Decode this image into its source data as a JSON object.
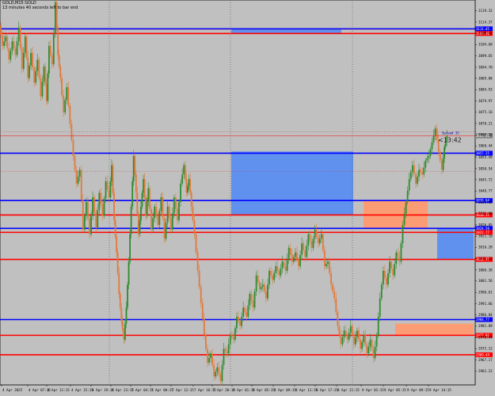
{
  "header": {
    "symbol_line": "GOLD,M15 GOLD",
    "timer_line": "13 minutes 40 seconds left to bar end"
  },
  "countdown": "<13:42",
  "spread_label": "Spread 35",
  "colors": {
    "background": "#c0c0c0",
    "bull_candle": "#2e8b2e",
    "bear_candle": "#e07a3c",
    "support_line": "#ff0000",
    "resistance_line": "#0000ff",
    "demand_zone": "#5c8ef0",
    "supply_zone": "#ff9a70",
    "price_line": "#ff0000"
  },
  "chart_data": {
    "type": "candlestick",
    "current_price": 3064.8,
    "ylim": [
      2956.3,
      3124.0
    ],
    "y_ticks": [
      "3119.32",
      "3114.37",
      "3109.42",
      "3104.60",
      "3099.65",
      "3094.70",
      "3089.88",
      "3084.93",
      "3079.97",
      "3075.16",
      "3070.21",
      "3065.26",
      "3060.44",
      "3055.49",
      "3050.54",
      "3045.72",
      "3040.77",
      "3035.82",
      "3031.00",
      "3026.05",
      "3021.10",
      "3016.28",
      "3011.33",
      "3006.38",
      "3001.56",
      "2996.61",
      "2991.66",
      "2986.84",
      "2981.89",
      "2976.94",
      "2972.12",
      "2967.17",
      "2962.22"
    ],
    "x_labels": [
      "4 Apr 2025",
      "4 Apr 07:15",
      "4 Apr 11:15",
      "4 Apr 15:15",
      "4 Apr 19:15",
      "4 Apr 23:15",
      "7 Apr 04:15",
      "7 Apr 08:15",
      "7 Apr 12:15",
      "7 Apr 16:15",
      "7 Apr 20:15",
      "8 Apr 01:15",
      "8 Apr 05:15",
      "8 Apr 09:15",
      "8 Apr 13:15",
      "8 Apr 17:15",
      "8 Apr 21:15",
      "9 Apr 01:15",
      "9 Apr 05:15",
      "9 Apr 09:15",
      "9 Apr 14:15"
    ],
    "horizontal_levels": [
      {
        "price": 3111.45,
        "label": "3111.45",
        "kind": "resistance"
      },
      {
        "price": 3109.4,
        "label": "3109.40",
        "kind": "support"
      },
      {
        "price": 3057.25,
        "label": "3057.25",
        "kind": "resistance"
      },
      {
        "price": 3036.64,
        "label": "3036.64",
        "kind": "resistance"
      },
      {
        "price": 3030.35,
        "label": "3030.35",
        "kind": "support"
      },
      {
        "price": 3024.5,
        "label": "3024.50",
        "kind": "resistance"
      },
      {
        "price": 3022.77,
        "label": "3022.77",
        "kind": "support"
      },
      {
        "price": 3010.97,
        "label": "3010.97",
        "kind": "support"
      },
      {
        "price": 2984.77,
        "label": "2984.77",
        "kind": "resistance"
      },
      {
        "price": 2977.91,
        "label": "2977.91",
        "kind": "support"
      },
      {
        "price": 2969.44,
        "label": "2969.44",
        "kind": "support"
      }
    ],
    "dotted_levels": [
      3111.0,
      3066.5,
      3049.4
    ],
    "zones": [
      {
        "kind": "demand",
        "from": "7 Apr 23:45",
        "to": "8 Apr 18:15",
        "top": 3111.45,
        "bottom": 3109.4
      },
      {
        "kind": "demand",
        "from": "7 Apr 23:45",
        "to": "8 Apr 21:45",
        "top": 3058.0,
        "bottom": 3030.35
      },
      {
        "kind": "supply",
        "from": "9 Apr 04:15",
        "to": "9 Apr 08:45",
        "top": 3036.64,
        "bottom": 3024.5
      },
      {
        "kind": "demand",
        "from": "9 Apr 09:15",
        "to": "9 Apr 13:00",
        "top": 3024.5,
        "bottom": 3010.97
      },
      {
        "kind": "supply",
        "from": "9 Apr 05:45",
        "to": "9 Apr 13:00",
        "top": 2983.0,
        "bottom": 2977.91
      }
    ],
    "price_path": [
      [
        0,
        3113
      ],
      [
        4,
        3104
      ],
      [
        8,
        3108
      ],
      [
        12,
        3098
      ],
      [
        16,
        3106
      ],
      [
        20,
        3100
      ],
      [
        24,
        3112
      ],
      [
        28,
        3094
      ],
      [
        32,
        3108
      ],
      [
        35,
        3090
      ],
      [
        39,
        3101
      ],
      [
        43,
        3088
      ],
      [
        47,
        3098
      ],
      [
        51,
        3082
      ],
      [
        55,
        3095
      ],
      [
        58,
        3080
      ],
      [
        61,
        3104
      ],
      [
        65,
        3096
      ],
      [
        69,
        3123
      ],
      [
        72,
        3100
      ],
      [
        75,
        3090
      ],
      [
        79,
        3075
      ],
      [
        83,
        3086
      ],
      [
        87,
        3070
      ],
      [
        91,
        3056
      ],
      [
        95,
        3044
      ],
      [
        99,
        3050
      ],
      [
        103,
        3024
      ],
      [
        107,
        3036
      ],
      [
        111,
        3022
      ],
      [
        115,
        3038
      ],
      [
        119,
        3025
      ],
      [
        123,
        3040
      ],
      [
        127,
        3030
      ],
      [
        131,
        3045
      ],
      [
        135,
        3038
      ],
      [
        138,
        3052
      ],
      [
        141,
        3028
      ],
      [
        144,
        3014
      ],
      [
        147,
        2996
      ],
      [
        150,
        2984
      ],
      [
        153,
        2976
      ],
      [
        156,
        2990
      ],
      [
        159,
        3010
      ],
      [
        162,
        3034
      ],
      [
        165,
        3056
      ],
      [
        168,
        3040
      ],
      [
        171,
        3022
      ],
      [
        174,
        3034
      ],
      [
        177,
        3046
      ],
      [
        180,
        3030
      ],
      [
        183,
        3042
      ],
      [
        187,
        3024
      ],
      [
        191,
        3034
      ],
      [
        195,
        3026
      ],
      [
        199,
        3038
      ],
      [
        203,
        3020
      ],
      [
        207,
        3034
      ],
      [
        211,
        3024
      ],
      [
        215,
        3038
      ],
      [
        219,
        3028
      ],
      [
        223,
        3044
      ],
      [
        227,
        3052
      ],
      [
        230,
        3040
      ],
      [
        233,
        3046
      ],
      [
        236,
        3034
      ],
      [
        240,
        3022
      ],
      [
        244,
        3006
      ],
      [
        248,
        2992
      ],
      [
        252,
        2978
      ],
      [
        256,
        2966
      ],
      [
        260,
        2970
      ],
      [
        264,
        2960
      ],
      [
        268,
        2964
      ],
      [
        272,
        2958
      ],
      [
        276,
        2972
      ],
      [
        280,
        2970
      ],
      [
        284,
        2978
      ],
      [
        288,
        2976
      ],
      [
        292,
        2986
      ],
      [
        296,
        2982
      ],
      [
        300,
        2990
      ],
      [
        304,
        2986
      ],
      [
        308,
        2996
      ],
      [
        312,
        2990
      ],
      [
        316,
        3004
      ],
      [
        320,
        2998
      ],
      [
        324,
        3000
      ],
      [
        328,
        2994
      ],
      [
        332,
        3006
      ],
      [
        336,
        3002
      ],
      [
        340,
        3008
      ],
      [
        344,
        3004
      ],
      [
        348,
        3010
      ],
      [
        352,
        3006
      ],
      [
        356,
        3016
      ],
      [
        360,
        3010
      ],
      [
        364,
        3014
      ],
      [
        368,
        3008
      ],
      [
        372,
        3018
      ],
      [
        376,
        3012
      ],
      [
        380,
        3022
      ],
      [
        384,
        3016
      ],
      [
        388,
        3024
      ],
      [
        392,
        3018
      ],
      [
        396,
        3022
      ],
      [
        400,
        3008
      ],
      [
        404,
        3010
      ],
      [
        408,
        3000
      ],
      [
        412,
        2994
      ],
      [
        416,
        2982
      ],
      [
        420,
        2974
      ],
      [
        424,
        2980
      ],
      [
        428,
        2976
      ],
      [
        432,
        2982
      ],
      [
        436,
        2974
      ],
      [
        440,
        2980
      ],
      [
        444,
        2972
      ],
      [
        448,
        2978
      ],
      [
        452,
        2970
      ],
      [
        456,
        2976
      ],
      [
        460,
        2968
      ],
      [
        464,
        2978
      ],
      [
        468,
        2994
      ],
      [
        472,
        3006
      ],
      [
        476,
        3000
      ],
      [
        480,
        3010
      ],
      [
        484,
        3004
      ],
      [
        488,
        3014
      ],
      [
        492,
        3010
      ],
      [
        496,
        3026
      ],
      [
        500,
        3036
      ],
      [
        504,
        3046
      ],
      [
        508,
        3052
      ],
      [
        512,
        3044
      ],
      [
        516,
        3050
      ],
      [
        520,
        3048
      ],
      [
        524,
        3054
      ],
      [
        528,
        3056
      ],
      [
        532,
        3062
      ],
      [
        536,
        3068
      ],
      [
        540,
        3058
      ],
      [
        544,
        3050
      ],
      [
        547,
        3060
      ],
      [
        550,
        3064.8
      ]
    ]
  }
}
